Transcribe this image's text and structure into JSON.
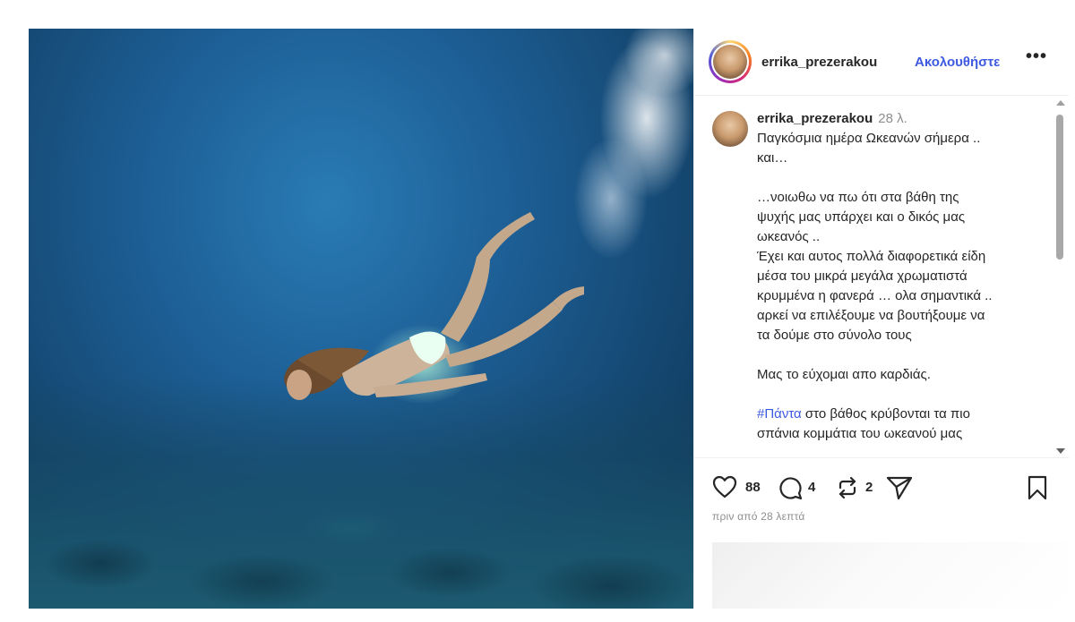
{
  "post": {
    "image_alt": "underwater diver",
    "author": {
      "username": "errika_prezerakou",
      "follow_label": "Ακολουθήστε",
      "more_label": "•••"
    },
    "caption": {
      "username": "errika_prezerakou",
      "time": "28 λ.",
      "text_1": "Παγκόσμια ημέρα Ωκεανών σήμερα ..\nκαι…\n\n…νοιωθω να πω ότι στα βάθη της\nψυχής μας υπάρχει  και ο δικός μας\nωκεανός ..\nΈχει και αυτος πολλά διαφορετικά είδη\nμέσα του  μικρά μεγάλα χρωματιστά\nκρυμμένα η φανερά … ολα σημαντικά ..\nαρκεί να επιλέξουμε να βουτήξουμε να\nτα δούμε στο σύνολο τους\n\nΜας το εύχομαι απο καρδιάς.\n\n",
      "hashtag": "#Πάντα",
      "text_2": " στο βάθος κρύβονται τα πιο\nσπάνια κομμάτια του ωκεανού μας"
    },
    "actions": {
      "likes": "88",
      "comments": "4",
      "reposts": "2",
      "icons": [
        "heart-icon",
        "comment-icon",
        "repost-icon",
        "share-icon",
        "bookmark-icon"
      ]
    },
    "posted_ago": "πριν από 28 λεπτά"
  },
  "colors": {
    "link_blue": "#3d5ae0",
    "muted": "#8e8e8e",
    "text": "#262626"
  }
}
